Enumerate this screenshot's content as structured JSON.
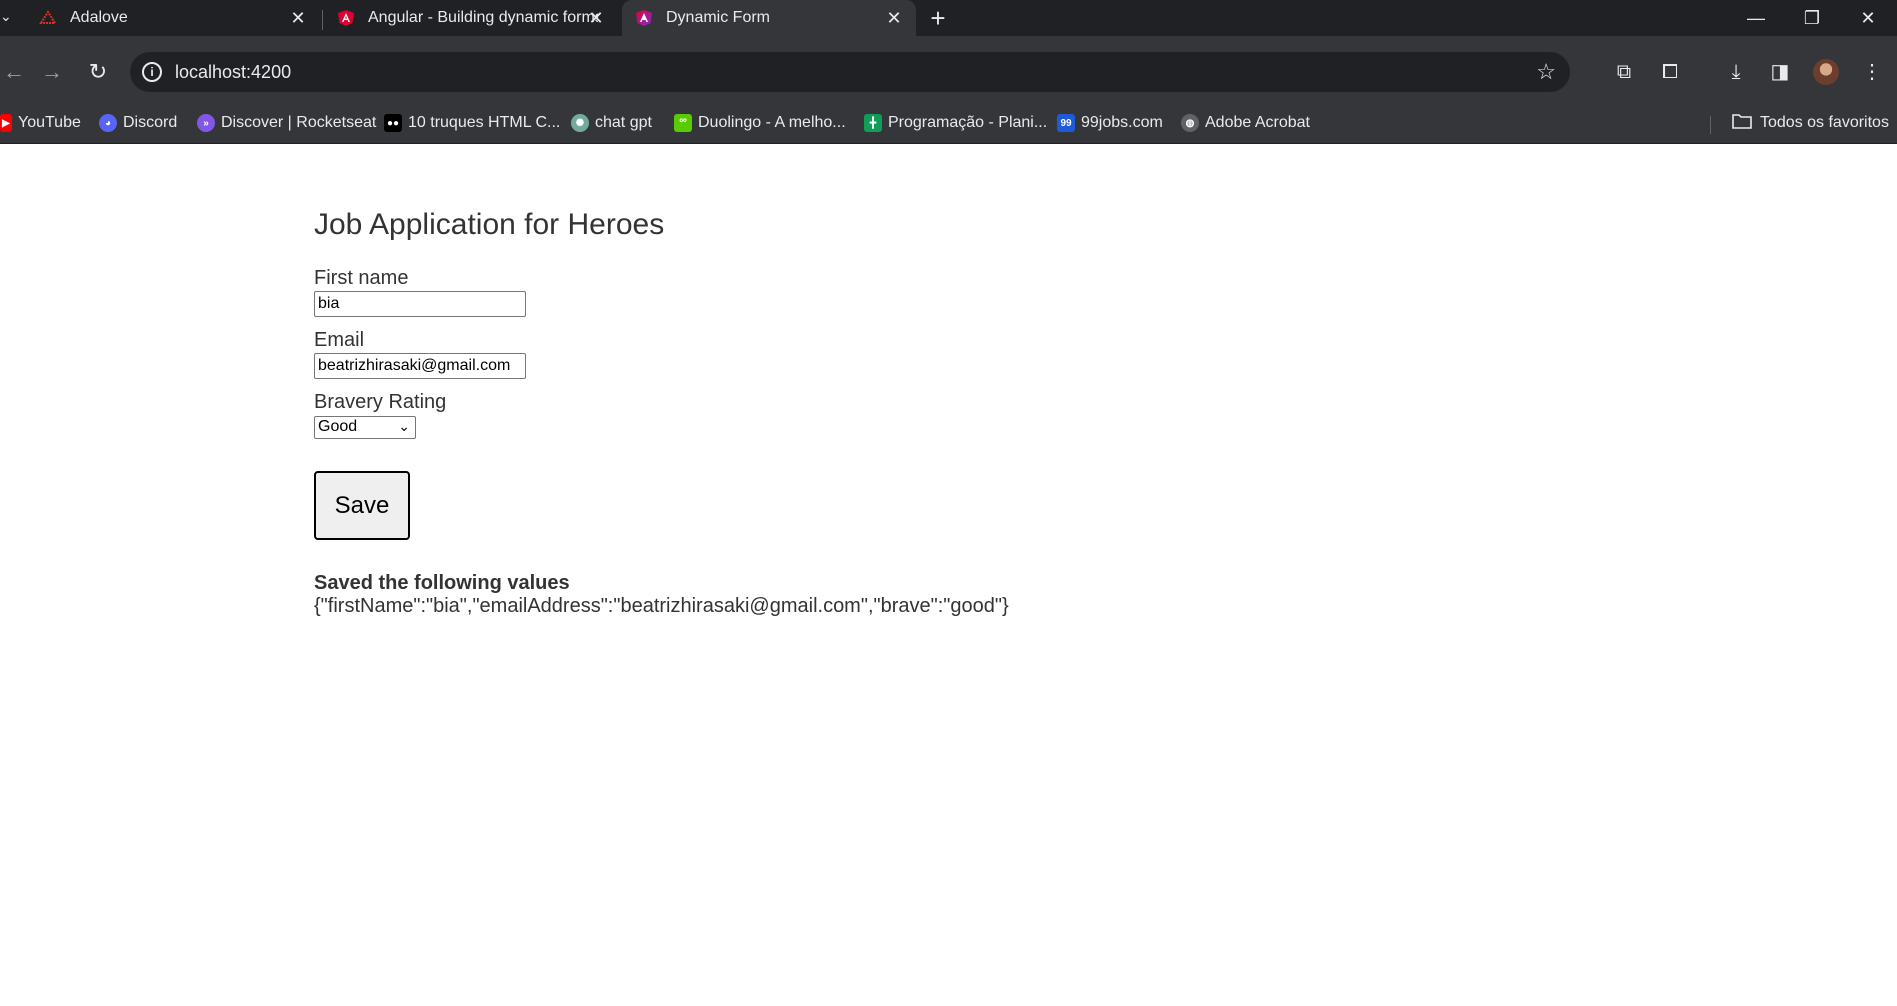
{
  "browser": {
    "tabs": [
      {
        "title": "Adalove",
        "favicon": "adalove-icon",
        "active": false
      },
      {
        "title": "Angular - Building dynamic forms",
        "favicon": "angular-icon",
        "active": false
      },
      {
        "title": "Dynamic Form",
        "favicon": "angular-dev-icon",
        "active": true
      }
    ],
    "address": "localhost:4200",
    "bookmarks": [
      {
        "label": "YouTube",
        "icon": "youtube-icon",
        "color": "#ff0000"
      },
      {
        "label": "Discord",
        "icon": "discord-icon",
        "color": "#5865f2"
      },
      {
        "label": "Discover | Rocketseat",
        "icon": "rocketseat-icon",
        "color": "#8257e5"
      },
      {
        "label": "10 truques HTML C...",
        "icon": "medium-icon",
        "color": "#000000"
      },
      {
        "label": "chat gpt",
        "icon": "chatgpt-icon",
        "color": "#74aa9c"
      },
      {
        "label": "Duolingo - A melho...",
        "icon": "duolingo-icon",
        "color": "#58cc02"
      },
      {
        "label": "Programação - Plani...",
        "icon": "sheets-icon",
        "color": "#0f9d58"
      },
      {
        "label": "99jobs.com",
        "icon": "99jobs-icon",
        "color": "#1e5bd8"
      },
      {
        "label": "Adobe Acrobat",
        "icon": "globe-icon",
        "color": "#9aa0a6"
      }
    ],
    "all_bookmarks": "Todos os favoritos"
  },
  "form": {
    "title": "Job Application for Heroes",
    "first_name_label": "First name",
    "first_name_value": "bia",
    "email_label": "Email",
    "email_value": "beatrizhirasaki@gmail.com",
    "bravery_label": "Bravery Rating",
    "bravery_value": "Good",
    "save_label": "Save"
  },
  "result": {
    "heading": "Saved the following values",
    "payload": "{\"firstName\":\"bia\",\"emailAddress\":\"beatrizhirasaki@gmail.com\",\"brave\":\"good\"}"
  }
}
